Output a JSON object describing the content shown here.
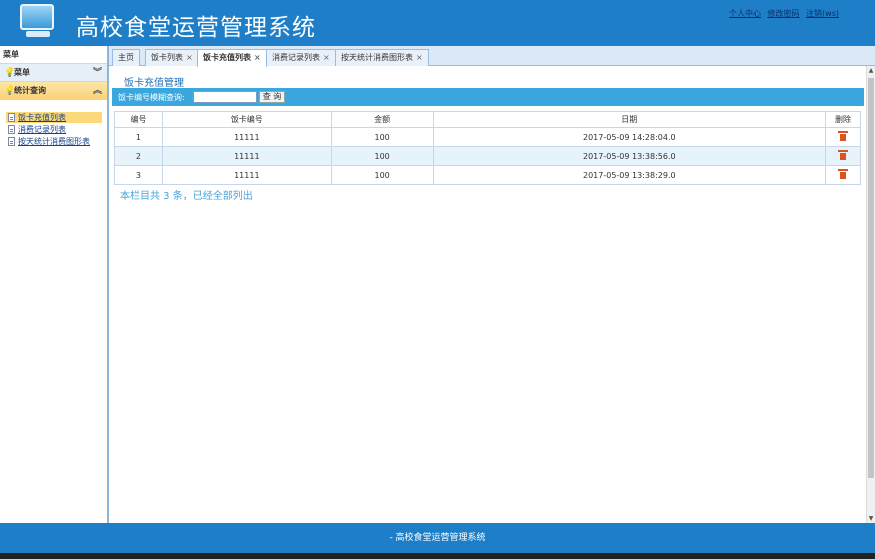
{
  "header": {
    "title": "高校食堂运营管理系统",
    "links": [
      "个人中心",
      "修改密码",
      "注销(ws)"
    ]
  },
  "sidebar": {
    "menu_label": "菜单",
    "groups": [
      {
        "label": "菜单"
      },
      {
        "label": "统计查询"
      }
    ],
    "items": [
      {
        "label": "饭卡充值列表"
      },
      {
        "label": "消费记录列表"
      },
      {
        "label": "按天统计消费图形表"
      }
    ]
  },
  "tabs": [
    {
      "label": "主页"
    },
    {
      "label": "饭卡列表"
    },
    {
      "label": "饭卡充值列表"
    },
    {
      "label": "消费记录列表"
    },
    {
      "label": "按天统计消费图形表"
    }
  ],
  "page": {
    "title": "饭卡充值管理",
    "search_label": "饭卡编号模糊查询:",
    "search_value": "",
    "search_button": "查 询"
  },
  "table": {
    "headers": [
      "编号",
      "饭卡编号",
      "金额",
      "日期",
      "删除"
    ],
    "rows": [
      {
        "id": "1",
        "card": "11111",
        "amount": "100",
        "date": "2017-05-09 14:28:04.0"
      },
      {
        "id": "2",
        "card": "11111",
        "amount": "100",
        "date": "2017-05-09 13:38:56.0"
      },
      {
        "id": "3",
        "card": "11111",
        "amount": "100",
        "date": "2017-05-09 13:38:29.0"
      }
    ],
    "summary": "本栏目共 3 条，已经全部列出"
  },
  "footer": {
    "text": "- 高校食堂运营管理系统"
  },
  "colors": {
    "primary": "#1e7fc8",
    "accent": "#3aa7de",
    "delete": "#d9541e"
  }
}
